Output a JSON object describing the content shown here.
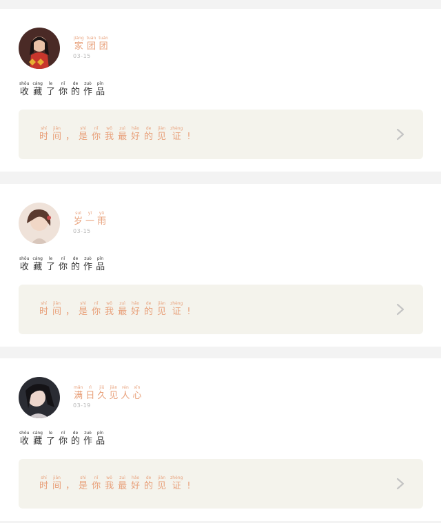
{
  "posts": [
    {
      "user": {
        "name": [
          {
            "py": "jiāng",
            "hz": "家"
          },
          {
            "py": "tuán",
            "hz": "团"
          },
          {
            "py": "tuán",
            "hz": "团"
          }
        ]
      },
      "date": "03-15",
      "message": [
        {
          "py": "shōu",
          "hz": "收"
        },
        {
          "py": "cáng",
          "hz": "藏"
        },
        {
          "py": "le",
          "hz": "了"
        },
        {
          "py": "nǐ",
          "hz": "你"
        },
        {
          "py": "de",
          "hz": "的"
        },
        {
          "py": "zuò",
          "hz": "作"
        },
        {
          "py": "pǐn",
          "hz": "品"
        }
      ],
      "link": [
        {
          "py": "shí",
          "hz": "时"
        },
        {
          "py": "jiān",
          "hz": "间"
        },
        {
          "py": "",
          "hz": "，"
        },
        {
          "py": "shì",
          "hz": "是"
        },
        {
          "py": "nǐ",
          "hz": "你"
        },
        {
          "py": "wǒ",
          "hz": "我"
        },
        {
          "py": "zuì",
          "hz": "最"
        },
        {
          "py": "hǎo",
          "hz": "好"
        },
        {
          "py": "de",
          "hz": "的"
        },
        {
          "py": "jiàn",
          "hz": "见"
        },
        {
          "py": "zhèng",
          "hz": "证"
        },
        {
          "py": "",
          "hz": "!"
        }
      ]
    },
    {
      "user": {
        "name": [
          {
            "py": "suì",
            "hz": "岁"
          },
          {
            "py": "yī",
            "hz": "一"
          },
          {
            "py": "yǔ",
            "hz": "雨"
          }
        ]
      },
      "date": "03-15",
      "message": [
        {
          "py": "shōu",
          "hz": "收"
        },
        {
          "py": "cáng",
          "hz": "藏"
        },
        {
          "py": "le",
          "hz": "了"
        },
        {
          "py": "nǐ",
          "hz": "你"
        },
        {
          "py": "de",
          "hz": "的"
        },
        {
          "py": "zuò",
          "hz": "作"
        },
        {
          "py": "pǐn",
          "hz": "品"
        }
      ],
      "link": [
        {
          "py": "shí",
          "hz": "时"
        },
        {
          "py": "jiān",
          "hz": "间"
        },
        {
          "py": "",
          "hz": "，"
        },
        {
          "py": "shì",
          "hz": "是"
        },
        {
          "py": "nǐ",
          "hz": "你"
        },
        {
          "py": "wǒ",
          "hz": "我"
        },
        {
          "py": "zuì",
          "hz": "最"
        },
        {
          "py": "hǎo",
          "hz": "好"
        },
        {
          "py": "de",
          "hz": "的"
        },
        {
          "py": "jiàn",
          "hz": "见"
        },
        {
          "py": "zhèng",
          "hz": "证"
        },
        {
          "py": "",
          "hz": "!"
        }
      ]
    },
    {
      "user": {
        "name": [
          {
            "py": "mǎn",
            "hz": "满"
          },
          {
            "py": "rì",
            "hz": "日"
          },
          {
            "py": "jiǔ",
            "hz": "久"
          },
          {
            "py": "jiàn",
            "hz": "见"
          },
          {
            "py": "rén",
            "hz": "人"
          },
          {
            "py": "xīn",
            "hz": "心"
          }
        ]
      },
      "date": "03-19",
      "message": [
        {
          "py": "shōu",
          "hz": "收"
        },
        {
          "py": "cáng",
          "hz": "藏"
        },
        {
          "py": "le",
          "hz": "了"
        },
        {
          "py": "nǐ",
          "hz": "你"
        },
        {
          "py": "de",
          "hz": "的"
        },
        {
          "py": "zuò",
          "hz": "作"
        },
        {
          "py": "pǐn",
          "hz": "品"
        }
      ],
      "link": [
        {
          "py": "shí",
          "hz": "时"
        },
        {
          "py": "jiān",
          "hz": "间"
        },
        {
          "py": "",
          "hz": "，"
        },
        {
          "py": "shì",
          "hz": "是"
        },
        {
          "py": "nǐ",
          "hz": "你"
        },
        {
          "py": "wǒ",
          "hz": "我"
        },
        {
          "py": "zuì",
          "hz": "最"
        },
        {
          "py": "hǎo",
          "hz": "好"
        },
        {
          "py": "de",
          "hz": "的"
        },
        {
          "py": "jiàn",
          "hz": "见"
        },
        {
          "py": "zhèng",
          "hz": "证"
        },
        {
          "py": "",
          "hz": "!"
        }
      ]
    }
  ],
  "colors": {
    "accent": "#e8a07a",
    "text": "#333333",
    "muted": "#b8b8b8",
    "link_bg": "#f4f3ec",
    "page_bg": "#f3f3f3"
  },
  "icons": {
    "chevron": "chevron-right-icon"
  }
}
